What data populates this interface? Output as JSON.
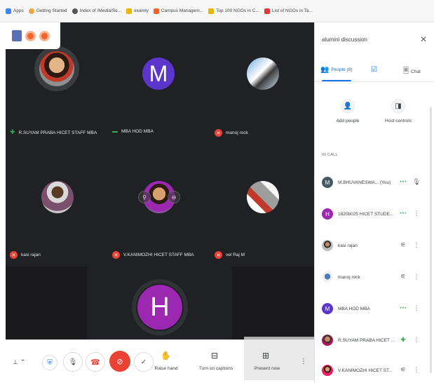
{
  "bookmarks": [
    {
      "label": "Apps",
      "color": "#4285f4"
    },
    {
      "label": "Getting Started",
      "color": "#f4a340"
    },
    {
      "label": "Index of /Media/Se...",
      "color": "#555555"
    },
    {
      "label": "examly",
      "color": "#e9b500"
    },
    {
      "label": "Campus Managem...",
      "color": "#f0642c"
    },
    {
      "label": "Top 100 NGOs in C...",
      "color": "#e9b500"
    },
    {
      "label": "List of NGOs in Ta...",
      "color": "#e53935"
    }
  ],
  "tiles": [
    {
      "name": "R.SUYAM PRABA HICET STAFF MBA",
      "mic": "speaking"
    },
    {
      "name": "MBA HOD MBA",
      "mic": "on",
      "initial": "M"
    },
    {
      "name": "manoj rock",
      "mic": "muted"
    },
    {
      "name": "kasi rajan",
      "mic": "muted"
    },
    {
      "name": "V.KANIMOZHI HICET STAFF MBA",
      "mic": "muted"
    },
    {
      "name": "vel Raj M",
      "mic": "muted"
    },
    {
      "name": "",
      "initial": "H"
    }
  ],
  "controls": {
    "raise_hand": "Raise hand",
    "captions": "Turn on captions",
    "present": "Present now"
  },
  "panel": {
    "title": "alumini discussion",
    "tabs": {
      "people": "People (8)",
      "chat": "Chat"
    },
    "add_people": "Add people",
    "host_controls": "Host controls",
    "in_call": "IN CALL",
    "participants": [
      {
        "name": "M.BHUVANESWA...  (You)",
        "initial": "M",
        "color": "#455a64",
        "status": "on"
      },
      {
        "name": "1820b025 HICET STUDE...",
        "initial": "H",
        "color": "#9c27b0",
        "status": "on"
      },
      {
        "name": "kasi rajan",
        "color": "#5d4037",
        "status": "muted"
      },
      {
        "name": "manoj rock",
        "color": "#4a7fc1",
        "status": "muted"
      },
      {
        "name": "MBA HOD MBA",
        "initial": "M",
        "color": "#5c35cc",
        "status": "on"
      },
      {
        "name": "R.SUYAM PRABA HICET ...",
        "color": "#c0392b",
        "status": "speaking"
      },
      {
        "name": "V.KANIMOZHI HICET ST...",
        "color": "#ad1457",
        "status": "muted"
      }
    ]
  },
  "colors": {
    "accent": "#1a73e8",
    "end_call": "#ea4335",
    "speaking": "#34a853",
    "muted": "#ea4335"
  }
}
